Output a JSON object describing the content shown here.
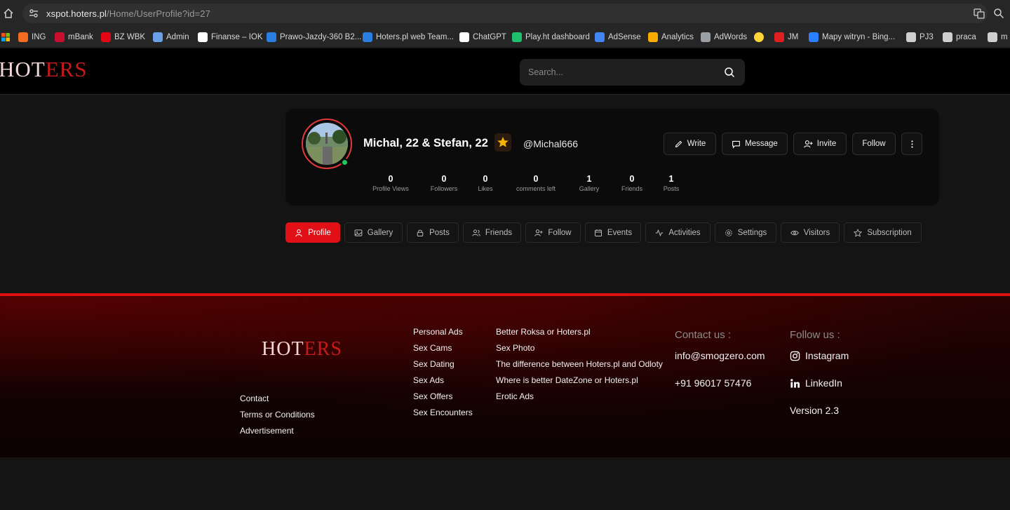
{
  "browser": {
    "url_host": "xspot.hoters.pl",
    "url_path": "/Home/UserProfile?id=27",
    "bookmarks": [
      {
        "label": "ING",
        "color": "#f36c21"
      },
      {
        "label": "mBank",
        "color": "#c8102e"
      },
      {
        "label": "BZ WBK",
        "color": "#e30613"
      },
      {
        "label": "Admin",
        "color": "#6aa0e8"
      },
      {
        "label": "Finanse – IOK",
        "color": "#ffffff"
      },
      {
        "label": "Prawo-Jazdy-360 B2...",
        "color": "#2b7de0"
      },
      {
        "label": "Hoters.pl web Team...",
        "color": "#2b7de0"
      },
      {
        "label": "ChatGPT",
        "color": "#ffffff"
      },
      {
        "label": "Play.ht dashboard",
        "color": "#1fbf6c"
      },
      {
        "label": "AdSense",
        "color": "#4285f4"
      },
      {
        "label": "Analytics",
        "color": "#f9ab00"
      },
      {
        "label": "AdWords",
        "color": "#9aa0a6"
      },
      {
        "label": "",
        "color": "#ffd43b"
      },
      {
        "label": "JM",
        "color": "#e02020"
      },
      {
        "label": "Mapy witryn - Bing...",
        "color": "#2a7fff"
      },
      {
        "label": "PJ3",
        "color": "#cfcfcf"
      },
      {
        "label": "praca",
        "color": "#cfcfcf"
      },
      {
        "label": "m",
        "color": "#cfcfcf"
      }
    ]
  },
  "header": {
    "logo_a": "HOT",
    "logo_b": "ERS",
    "search_placeholder": "Search..."
  },
  "profile": {
    "name": "Michal, 22 & Stefan, 22",
    "handle": "@Michal666",
    "actions": [
      "Write",
      "Message",
      "Invite",
      "Follow"
    ],
    "stats": [
      {
        "value": "0",
        "label": "Profile Views"
      },
      {
        "value": "0",
        "label": "Followers"
      },
      {
        "value": "0",
        "label": "Likes"
      },
      {
        "value": "0",
        "label": "comments left"
      },
      {
        "value": "1",
        "label": "Gallery"
      },
      {
        "value": "0",
        "label": "Friends"
      },
      {
        "value": "1",
        "label": "Posts"
      }
    ]
  },
  "tabs": [
    "Profile",
    "Gallery",
    "Posts",
    "Friends",
    "Follow",
    "Events",
    "Activities",
    "Settings",
    "Visitors",
    "Subscription"
  ],
  "footer": {
    "logo_a": "HOT",
    "logo_b": "ERS",
    "col1": [
      "Contact",
      "Terms or Conditions",
      "Advertisement"
    ],
    "col2": [
      "Personal Ads",
      "Sex Cams",
      "Sex Dating",
      "Sex Ads",
      "Sex Offers",
      "Sex Encounters"
    ],
    "col3": [
      "Better Roksa or Hoters.pl",
      "Sex Photo",
      "The difference between Hoters.pl and Odloty",
      "Where is better DateZone or Hoters.pl",
      "Erotic Ads"
    ],
    "contact_heading": "Contact us :",
    "email": "info@smogzero.com",
    "phone": "+91 96017 57476",
    "follow_heading": "Follow us :",
    "instagram": "Instagram",
    "linkedin": "LinkedIn",
    "version": "Version 2.3"
  },
  "colors": {
    "accent": "#e10f16",
    "online": "#22c55e",
    "star": "#f5b400"
  }
}
